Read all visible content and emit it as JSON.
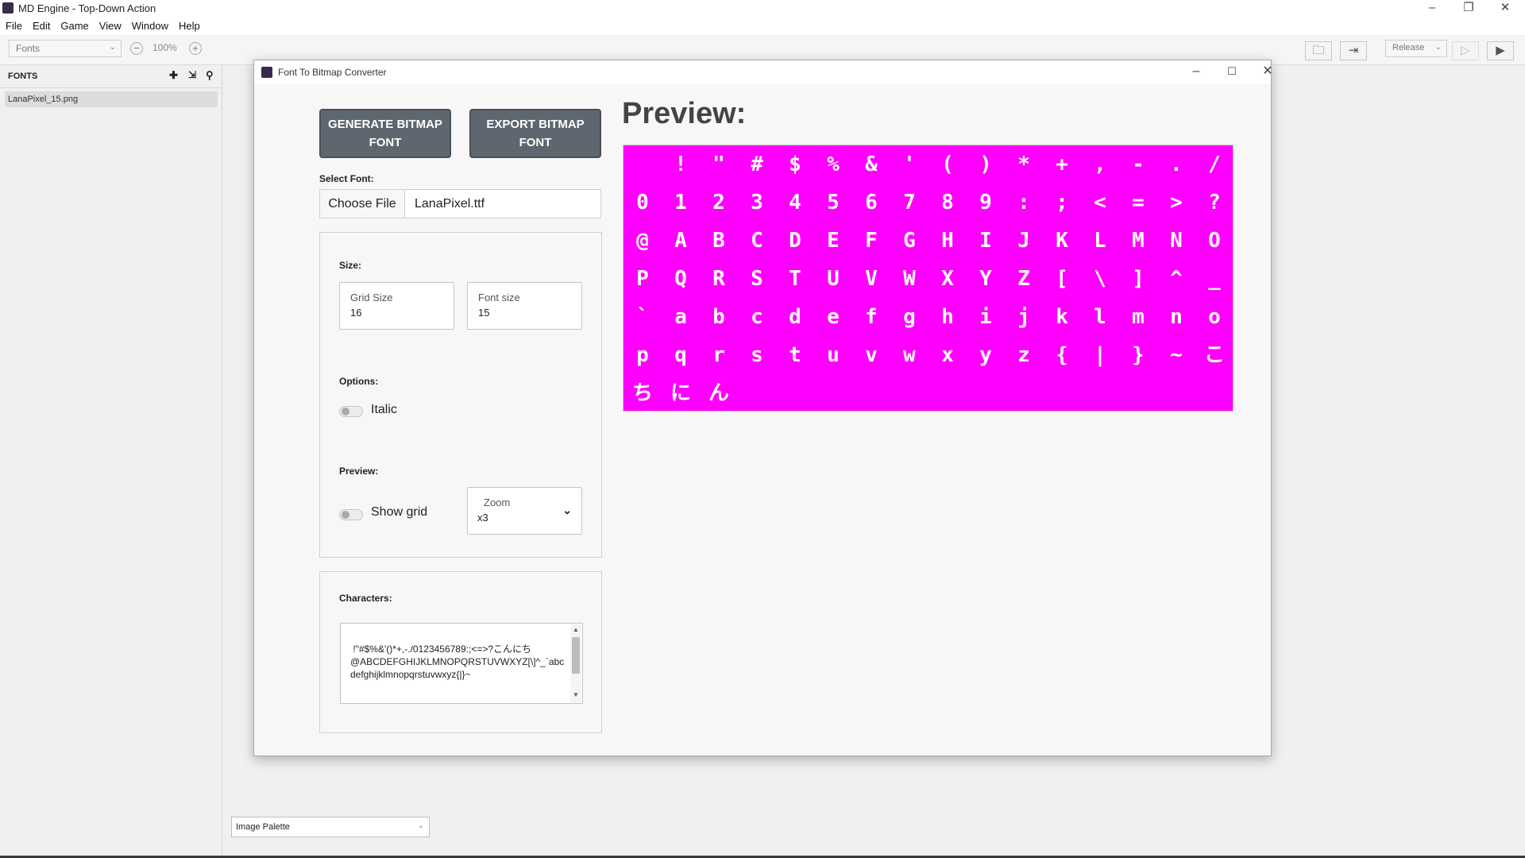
{
  "app": {
    "title": "MD Engine - Top-Down Action",
    "menu": [
      "File",
      "Edit",
      "Game",
      "View",
      "Window",
      "Help"
    ],
    "window_buttons": [
      "–",
      "❐",
      "✕"
    ]
  },
  "toolbar": {
    "editor_select": "Fonts",
    "zoom": "100%",
    "zoom_out": "−",
    "zoom_in": "+",
    "build_config": "Release",
    "icons": [
      "folder-icon",
      "export-icon",
      "play-outline-icon",
      "play-icon"
    ]
  },
  "fonts_panel": {
    "header": "FONTS",
    "items": [
      "LanaPixel_15.png"
    ]
  },
  "palette_select": "Image Palette",
  "dialog": {
    "title": "Font To Bitmap Converter",
    "window_buttons": [
      "–",
      "☐",
      "✕"
    ],
    "generate_button": "GENERATE BITMAP FONT",
    "export_button": "EXPORT BITMAP FONT",
    "select_font_label": "Select Font:",
    "choose_file_button": "Choose File",
    "file_name": "LanaPixel.ttf",
    "size_label": "Size:",
    "grid_size_label": "Grid Size",
    "grid_size_value": "16",
    "font_size_label": "Font size",
    "font_size_value": "15",
    "options_label": "Options:",
    "italic_label": "Italic",
    "italic_on": false,
    "preview_section_label": "Preview:",
    "show_grid_label": "Show grid",
    "show_grid_on": false,
    "zoom_label": "Zoom",
    "zoom_value": "x3",
    "characters_label": "Characters:",
    "characters_text": " !\"#$%&'()*+,-./0123456789:;<=>?こんにち\n@ABCDEFGHIJKLMNOPQRSTUVWXYZ[\\]^_`abcdefghijklmnopqrstuvwxyz{|}~",
    "preview_title": "Preview:",
    "preview_bg": "#ff00ff",
    "preview_rows": [
      [
        " ",
        "!",
        "\"",
        "#",
        "$",
        "%",
        "&",
        "'",
        "(",
        ")",
        "*",
        "+",
        ",",
        "-",
        ".",
        "/"
      ],
      [
        "0",
        "1",
        "2",
        "3",
        "4",
        "5",
        "6",
        "7",
        "8",
        "9",
        ":",
        ";",
        "<",
        "=",
        ">",
        "?"
      ],
      [
        "@",
        "A",
        "B",
        "C",
        "D",
        "E",
        "F",
        "G",
        "H",
        "I",
        "J",
        "K",
        "L",
        "M",
        "N",
        "O"
      ],
      [
        "P",
        "Q",
        "R",
        "S",
        "T",
        "U",
        "V",
        "W",
        "X",
        "Y",
        "Z",
        "[",
        "\\",
        "]",
        "^",
        "_"
      ],
      [
        "`",
        "a",
        "b",
        "c",
        "d",
        "e",
        "f",
        "g",
        "h",
        "i",
        "j",
        "k",
        "l",
        "m",
        "n",
        "o"
      ],
      [
        "p",
        "q",
        "r",
        "s",
        "t",
        "u",
        "v",
        "w",
        "x",
        "y",
        "z",
        "{",
        "|",
        "}",
        "~",
        "こ"
      ],
      [
        "ち",
        "に",
        "ん"
      ]
    ]
  }
}
